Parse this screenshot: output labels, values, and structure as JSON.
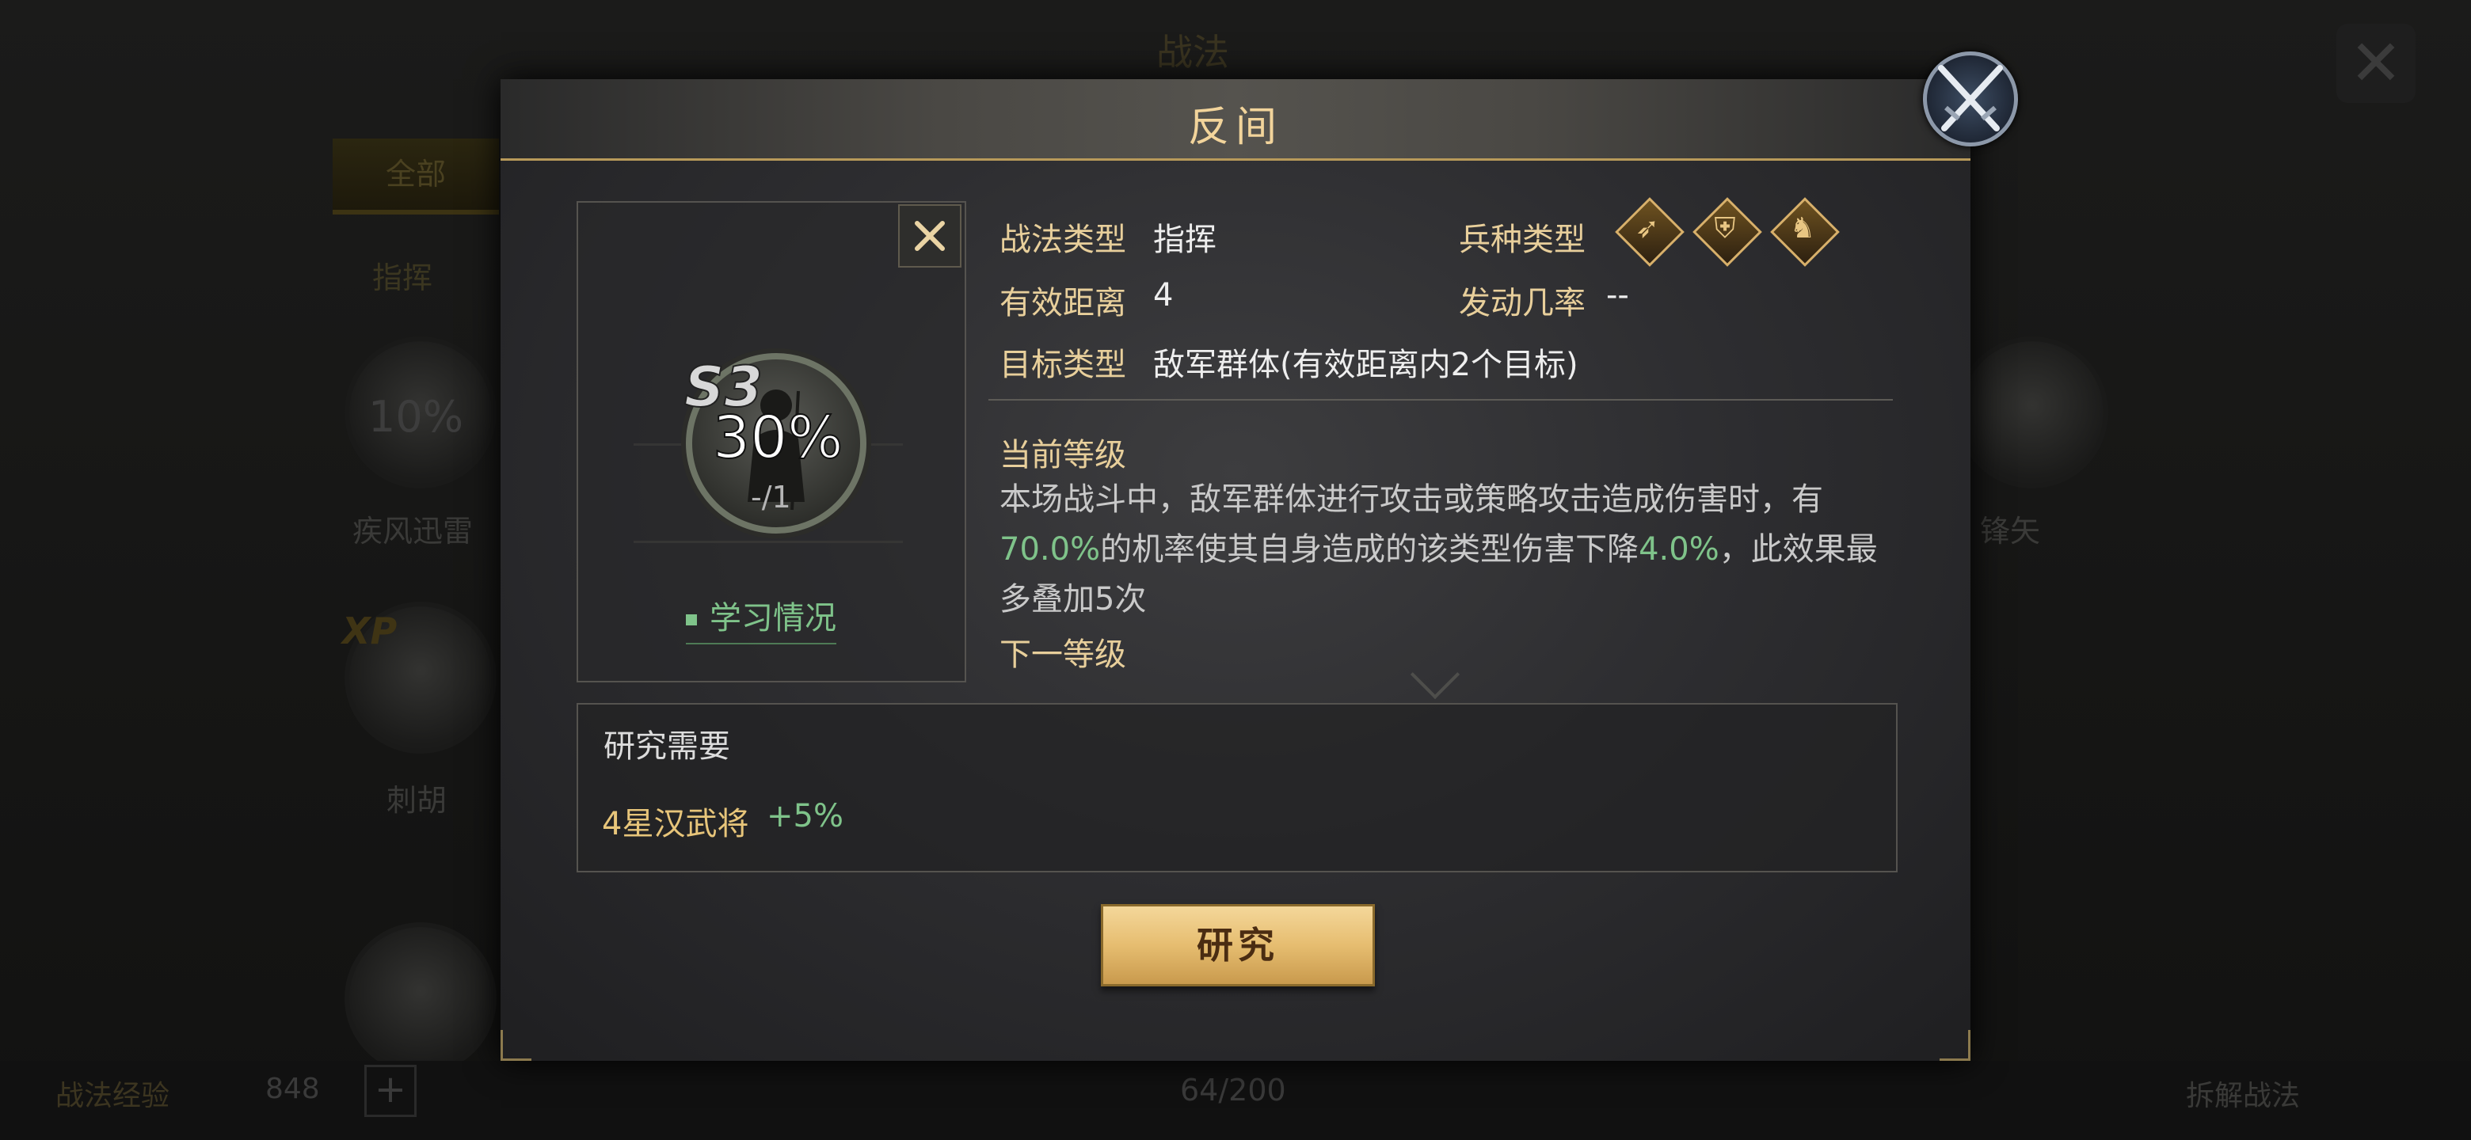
{
  "background": {
    "title": "战法",
    "tab_all": "全部",
    "category": "指挥",
    "skill_left_pct": "10%",
    "skill_left_name": "疾风迅雷",
    "xp_label": "XP",
    "skill_left2_name": "刺胡",
    "skill_right_name": "锋矢",
    "footer": {
      "exp_label": "战法经验",
      "exp_value": "848",
      "count": "64/200",
      "disband": "拆解战法"
    }
  },
  "modal": {
    "title": "反间",
    "skill": {
      "grade": "S3",
      "percent": "30%",
      "ratio": "-/1",
      "learn_link": "学习情况"
    },
    "info": {
      "type_label": "战法类型",
      "type_value": "指挥",
      "troop_label": "兵种类型",
      "troop_icons": [
        "bow-icon",
        "shield-icon",
        "horse-icon"
      ],
      "range_label": "有效距离",
      "range_value": "4",
      "rate_label": "发动几率",
      "rate_value": "--",
      "target_label": "目标类型",
      "target_value": "敌军群体(有效距离内2个目标)"
    },
    "current_level_label": "当前等级",
    "description": {
      "part1": "本场战斗中，敌军群体进行攻击或策略攻击造成伤害时，有",
      "rate": "70.0%",
      "part2": "的机率使其自身造成的该类型伤害下降",
      "reduction": "4.0%",
      "part3": "，此效果最多叠加5次"
    },
    "next_level_label": "下一等级",
    "research": {
      "title": "研究需要",
      "requirement": "4星汉武将",
      "bonus": "+5%"
    },
    "research_button": "研究"
  },
  "colors": {
    "gold_text": "#e8cf9b",
    "green_text": "#7fc38a",
    "button_gold": "#e6bd70"
  }
}
